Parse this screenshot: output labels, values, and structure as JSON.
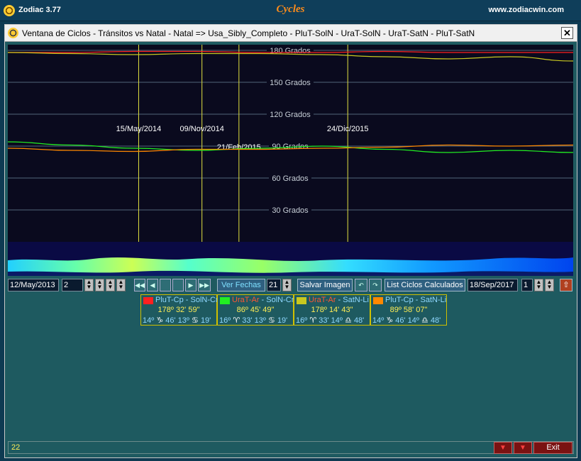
{
  "app": {
    "title": "Zodiac 3.77",
    "center_title": "Cycles",
    "url": "www.zodiacwin.com"
  },
  "window": {
    "title": "Ventana de Ciclos - Tránsitos vs Natal - Natal => Usa_Sibly_Completo - PluT-SolN - UraT-SolN - UraT-SatN - PluT-SatN",
    "close_label": "✕"
  },
  "chart_data": {
    "type": "line",
    "y_ticks": [
      "180 Grados",
      "150 Grados",
      "120 Grados",
      "90 Grados",
      "60 Grados",
      "30 Grados"
    ],
    "ylim": [
      0,
      180
    ],
    "xlim": [
      "12/May/2013",
      "18/Sep/2017"
    ],
    "date_markers": [
      "15/May/2014",
      "09/Nov/2014",
      "21/Feb/2015",
      "24/Dic/2015"
    ],
    "series": [
      {
        "name": "PluT-Cp - SolN-Cn",
        "color": "#ff2020",
        "values": [
          178,
          178,
          179,
          179,
          178,
          178,
          179,
          178,
          178,
          178
        ]
      },
      {
        "name": "UraT-Ar - SolN-Cn",
        "color": "#22ee22",
        "values": [
          94,
          91,
          88,
          86,
          88,
          90,
          87,
          84,
          86,
          84
        ]
      },
      {
        "name": "UraT-Ar - SatN-Li",
        "color": "#c8c820",
        "values": [
          178,
          177,
          176,
          177,
          177,
          176,
          174,
          172,
          174,
          170
        ]
      },
      {
        "name": "PluT-Cp - SatN-Li",
        "color": "#ff8800",
        "values": [
          88,
          86,
          85,
          87,
          87,
          88,
          89,
          91,
          90,
          91
        ]
      }
    ]
  },
  "toolbar": {
    "start_date": "12/May/2013",
    "step_value": "2",
    "ver_fechas_label": "Ver Fechas",
    "ver_fechas_value": "21",
    "salvar_label": "Salvar Imagen",
    "list_label": "List Ciclos Calculados",
    "end_date": "18/Sep/2017",
    "end_step": "1"
  },
  "legend": [
    {
      "name_a": "PluT-Cp",
      "name_b": "SolN-Cn",
      "color": "#ff2020",
      "name_a_color": "#8fd8ff",
      "name_b_color": "#8fd8ff",
      "deg": "178º 32' 59\"",
      "p1": "14º",
      "g1": "♑",
      "p2": "46'",
      "p3": "13º",
      "g2": "♋",
      "p4": "19'"
    },
    {
      "name_a": "UraT-Ar",
      "name_b": "SolN-Cn",
      "color": "#22ee22",
      "name_a_color": "#ff5533",
      "name_b_color": "#8fd8ff",
      "deg": "86º 45' 49\"",
      "p1": "16º",
      "g1": "♈",
      "p2": "33'",
      "p3": "13º",
      "g2": "♋",
      "p4": "19'"
    },
    {
      "name_a": "UraT-Ar",
      "name_b": "SatN-Li",
      "color": "#c8c820",
      "name_a_color": "#ff5533",
      "name_b_color": "#8fd8ff",
      "deg": "178º 14' 43\"",
      "p1": "16º",
      "g1": "♈",
      "p2": "33'",
      "p3": "14º",
      "g2": "♎",
      "p4": "48'"
    },
    {
      "name_a": "PluT-Cp",
      "name_b": "SatN-Li",
      "color": "#ff8800",
      "name_a_color": "#8fd8ff",
      "name_b_color": "#8fd8ff",
      "deg": "89º 58' 07\"",
      "p1": "14º",
      "g1": "♑",
      "p2": "46'",
      "p3": "14º",
      "g2": "♎",
      "p4": "48'"
    }
  ],
  "status": {
    "value": "22",
    "exit_label": "Exit",
    "btn1_label": "▼",
    "btn2_label": "▼"
  }
}
